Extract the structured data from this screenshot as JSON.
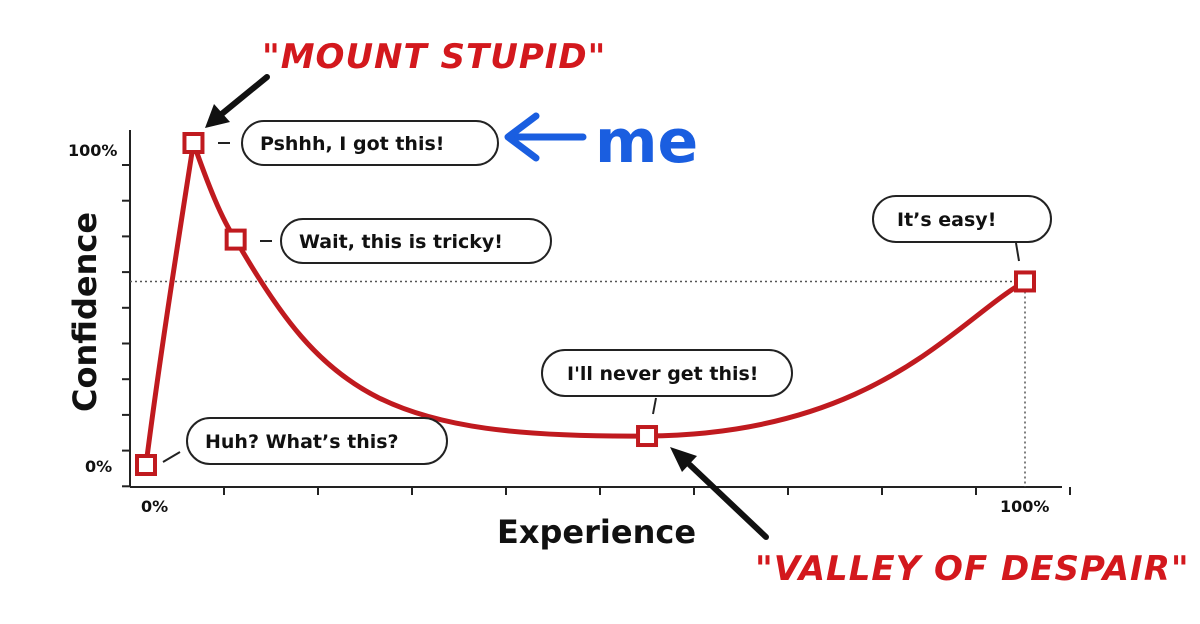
{
  "chart_data": {
    "type": "line",
    "xlabel": "Experience",
    "ylabel": "Confidence",
    "x_tick_labels": [
      "0%",
      "100%"
    ],
    "y_tick_labels": [
      "100%",
      "0%"
    ],
    "xlim": [
      0,
      100
    ],
    "ylim": [
      0,
      100
    ],
    "points": [
      {
        "x": 0,
        "y": 0,
        "label": "Huh? What’s this?"
      },
      {
        "x": 5.4,
        "y": 100,
        "label": "Pshhh, I got this!"
      },
      {
        "x": 10.2,
        "y": 70,
        "label": "Wait, this is tricky!"
      },
      {
        "x": 57,
        "y": 9,
        "label": "I'll never get this!"
      },
      {
        "x": 100,
        "y": 57,
        "label": "It’s easy!"
      }
    ],
    "reference_y": 57,
    "reference_x": 100,
    "grid": false,
    "line_color": "#c01a1f"
  },
  "annotations": {
    "mount_stupid": "\"MOUNT STUPID\"",
    "valley_of_despair": "\"VALLEY OF DESPAIR\"",
    "me": "me"
  },
  "colors": {
    "annotation_red": "#d3181d",
    "me_blue": "#1a5ee0",
    "ink": "#111111"
  }
}
